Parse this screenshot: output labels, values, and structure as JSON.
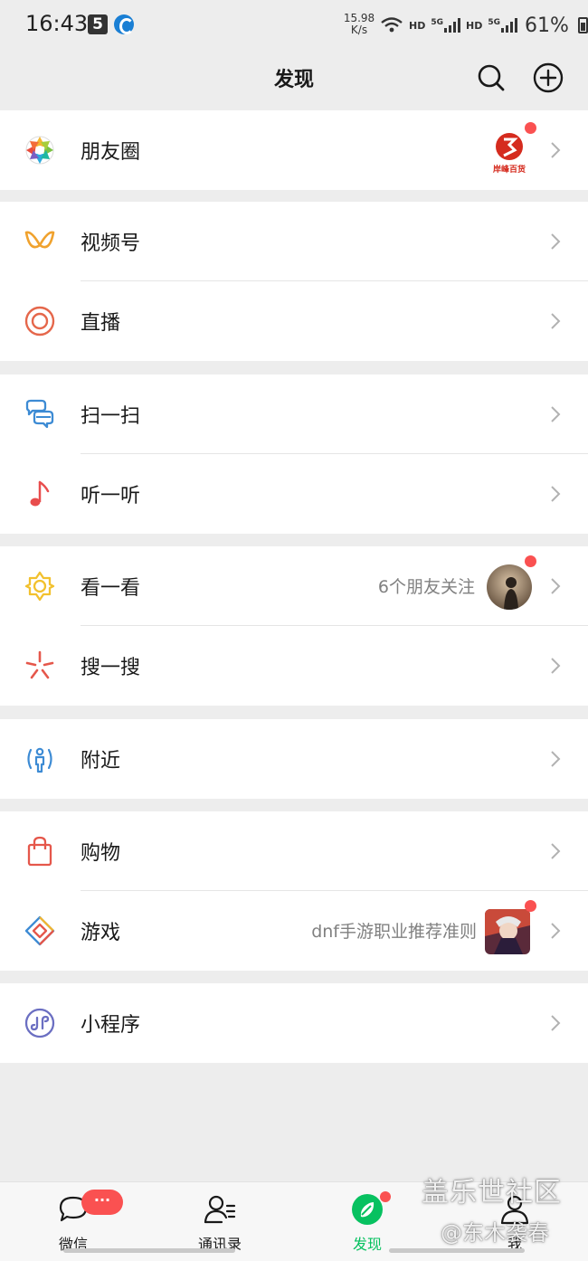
{
  "status_bar": {
    "time": "16:43",
    "app_badge": "5",
    "net_speed_value": "15.98",
    "net_speed_unit": "K/s",
    "hd1": "HD",
    "sig1": "5G",
    "hd2": "HD",
    "sig2": "5G",
    "battery": "61%"
  },
  "header": {
    "title": "发现",
    "search_icon": "search-icon",
    "add_icon": "plus-circle-icon"
  },
  "groups": [
    {
      "items": [
        {
          "label": "朋友圈",
          "icon": "moments-aperture-icon",
          "thumb_text": "岸峰百货",
          "has_dot": true
        }
      ]
    },
    {
      "items": [
        {
          "label": "视频号",
          "icon": "channels-icon"
        },
        {
          "label": "直播",
          "icon": "live-icon"
        }
      ]
    },
    {
      "items": [
        {
          "label": "扫一扫",
          "icon": "scan-icon"
        },
        {
          "label": "听一听",
          "icon": "music-note-icon"
        }
      ]
    },
    {
      "items": [
        {
          "label": "看一看",
          "icon": "top-stories-icon",
          "aside": "6个朋友关注",
          "has_dot": true
        },
        {
          "label": "搜一搜",
          "icon": "search-sparkle-icon"
        }
      ]
    },
    {
      "items": [
        {
          "label": "附近",
          "icon": "nearby-icon"
        }
      ]
    },
    {
      "items": [
        {
          "label": "购物",
          "icon": "shopping-bag-icon"
        },
        {
          "label": "游戏",
          "icon": "game-icon",
          "aside": "dnf手游职业推荐准则",
          "has_dot": true
        }
      ]
    },
    {
      "items": [
        {
          "label": "小程序",
          "icon": "mini-program-icon"
        }
      ]
    }
  ],
  "tabbar": {
    "badge": "···",
    "tabs": [
      {
        "label": "微信",
        "icon": "chat-icon"
      },
      {
        "label": "通讯录",
        "icon": "contacts-icon"
      },
      {
        "label": "发现",
        "icon": "compass-icon",
        "active": true
      },
      {
        "label": "我",
        "icon": "me-icon"
      }
    ]
  },
  "watermark": {
    "line1": "盖乐世社区",
    "line2": "@东木袭春"
  },
  "colors": {
    "accent_green": "#07c160",
    "red_dot": "#fa5151",
    "background": "#ededed"
  }
}
